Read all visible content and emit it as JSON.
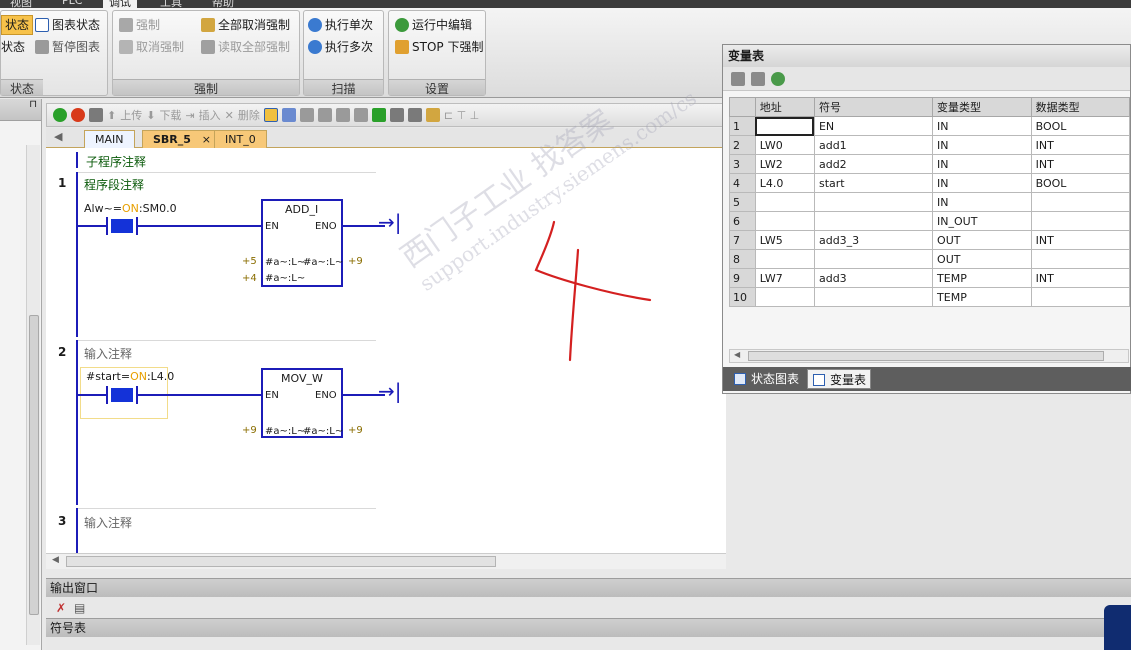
{
  "menu": {
    "tabs": [
      "视图",
      "PLC",
      "调试",
      "工具",
      "帮助"
    ],
    "active_index": 2
  },
  "ribbon": {
    "status_group": {
      "items": [
        "状态",
        "状态"
      ],
      "label": "状态"
    },
    "chart_group": {
      "chart_status": "图表状态",
      "pause_chart": "暂停图表"
    },
    "force_group": {
      "force": "强制",
      "unforce": "取消强制",
      "unforce_all": "全部取消强制",
      "read_all_forced": "读取全部强制",
      "label": "强制"
    },
    "scan_group": {
      "single": "执行单次",
      "multiple": "执行多次",
      "label": "扫描"
    },
    "settings_group": {
      "run_edit": "运行中编辑",
      "stop_force": "STOP 下强制",
      "label": "设置"
    }
  },
  "editor_toolbar": {
    "upload": "上传",
    "download": "下载",
    "insert": "插入",
    "delete": "删除"
  },
  "tabs": [
    {
      "label": "MAIN",
      "active": false
    },
    {
      "label": "SBR_5",
      "active": true,
      "closable": true
    },
    {
      "label": "INT_0",
      "active": false
    }
  ],
  "program": {
    "sub_comment": "子程序注释",
    "networks": [
      {
        "number": "1",
        "comment": "程序段注释",
        "contact_label_pre": "Alw~=",
        "contact_label_on": "ON",
        "contact_label_post": ":SM0.0",
        "box": "ADD_I",
        "pin_en": "EN",
        "pin_eno": "ENO",
        "in1_val": "+5",
        "in1": "#a~:L~",
        "in2_val": "+4",
        "in2": "#a~:L~",
        "out_val": "+9",
        "out": "#a~:L~"
      },
      {
        "number": "2",
        "comment": "输入注释",
        "contact_label_pre": "#start=",
        "contact_label_on": "ON",
        "contact_label_post": ":L4.0",
        "box": "MOV_W",
        "pin_en": "EN",
        "pin_eno": "ENO",
        "in1_val": "+9",
        "in1": "#a~:L~",
        "out_val": "+9",
        "out": "#a~:L~"
      },
      {
        "number": "3",
        "comment": "输入注释"
      }
    ]
  },
  "panels": {
    "output": "输出窗口",
    "symbols": "符号表"
  },
  "var_table": {
    "title": "变量表",
    "headers": [
      "地址",
      "符号",
      "变量类型",
      "数据类型"
    ],
    "rows": [
      {
        "n": "1",
        "addr": "",
        "sym": "EN",
        "vtype": "IN",
        "dtype": "BOOL"
      },
      {
        "n": "2",
        "addr": "LW0",
        "sym": "add1",
        "vtype": "IN",
        "dtype": "INT"
      },
      {
        "n": "3",
        "addr": "LW2",
        "sym": "add2",
        "vtype": "IN",
        "dtype": "INT"
      },
      {
        "n": "4",
        "addr": "L4.0",
        "sym": "start",
        "vtype": "IN",
        "dtype": "BOOL"
      },
      {
        "n": "5",
        "addr": "",
        "sym": "",
        "vtype": "IN",
        "dtype": ""
      },
      {
        "n": "6",
        "addr": "",
        "sym": "",
        "vtype": "IN_OUT",
        "dtype": ""
      },
      {
        "n": "7",
        "addr": "LW5",
        "sym": "add3_3",
        "vtype": "OUT",
        "dtype": "INT"
      },
      {
        "n": "8",
        "addr": "",
        "sym": "",
        "vtype": "OUT",
        "dtype": ""
      },
      {
        "n": "9",
        "addr": "LW7",
        "sym": "add3",
        "vtype": "TEMP",
        "dtype": "INT"
      },
      {
        "n": "10",
        "addr": "",
        "sym": "",
        "vtype": "TEMP",
        "dtype": ""
      }
    ],
    "bottom_tabs": [
      "状态图表",
      "变量表"
    ],
    "active_bottom_tab": 1
  },
  "watermark": {
    "line1": "西门子工业 找答案",
    "line2": "support.industry.siemens.com/cs"
  },
  "colors": {
    "wire": "#1c1cb8",
    "contact": "#1432d8",
    "on_text": "#e8a000",
    "value_text": "#8a6d00",
    "comment_green": "#0a5a0a",
    "handwriting": "#d42020"
  }
}
